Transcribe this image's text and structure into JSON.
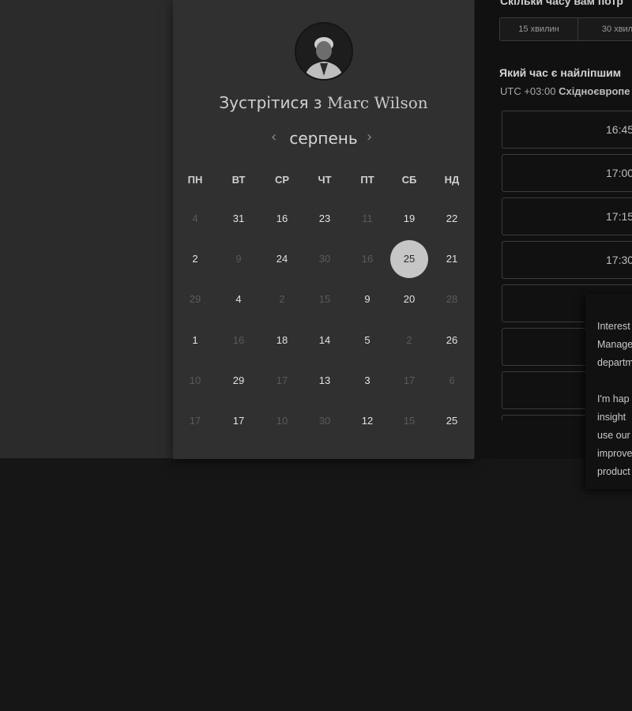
{
  "meeting": {
    "title_prefix": "Зустрітися з",
    "host_name": "Marc Wilson"
  },
  "calendar": {
    "month": "серпень",
    "prev_icon": "chevron-left-icon",
    "next_icon": "chevron-right-icon",
    "weekdays": [
      "ПН",
      "ВТ",
      "СР",
      "ЧТ",
      "ПТ",
      "СБ",
      "НД"
    ],
    "weeks": [
      [
        {
          "d": "4",
          "on": false
        },
        {
          "d": "31",
          "on": true
        },
        {
          "d": "16",
          "on": true
        },
        {
          "d": "23",
          "on": true
        },
        {
          "d": "11",
          "on": false
        },
        {
          "d": "19",
          "on": true
        },
        {
          "d": "22",
          "on": true
        }
      ],
      [
        {
          "d": "2",
          "on": true
        },
        {
          "d": "9",
          "on": false
        },
        {
          "d": "24",
          "on": true
        },
        {
          "d": "30",
          "on": false
        },
        {
          "d": "16",
          "on": false
        },
        {
          "d": "25",
          "on": true,
          "selected": true
        },
        {
          "d": "21",
          "on": true
        }
      ],
      [
        {
          "d": "29",
          "on": false
        },
        {
          "d": "4",
          "on": true
        },
        {
          "d": "2",
          "on": false
        },
        {
          "d": "15",
          "on": false
        },
        {
          "d": "9",
          "on": true
        },
        {
          "d": "20",
          "on": true
        },
        {
          "d": "28",
          "on": false
        }
      ],
      [
        {
          "d": "1",
          "on": true
        },
        {
          "d": "16",
          "on": false
        },
        {
          "d": "18",
          "on": true
        },
        {
          "d": "14",
          "on": true
        },
        {
          "d": "5",
          "on": true
        },
        {
          "d": "2",
          "on": false
        },
        {
          "d": "26",
          "on": true
        }
      ],
      [
        {
          "d": "10",
          "on": false
        },
        {
          "d": "29",
          "on": true
        },
        {
          "d": "17",
          "on": false
        },
        {
          "d": "13",
          "on": true
        },
        {
          "d": "3",
          "on": true
        },
        {
          "d": "17",
          "on": false
        },
        {
          "d": "6",
          "on": false
        }
      ],
      [
        {
          "d": "17",
          "on": false
        },
        {
          "d": "17",
          "on": true
        },
        {
          "d": "10",
          "on": false
        },
        {
          "d": "30",
          "on": false
        },
        {
          "d": "12",
          "on": true
        },
        {
          "d": "15",
          "on": false
        },
        {
          "d": "25",
          "on": true
        }
      ]
    ]
  },
  "duration": {
    "question": "Скільки часу вам потр",
    "options": [
      "15 хвилин",
      "30 хвил"
    ]
  },
  "best_time": {
    "question": "Який час є найліпшим",
    "tz_offset": "UTC +03:00",
    "tz_name": "Східноєвропе"
  },
  "slots": [
    "16:45",
    "17:00",
    "17:15",
    "17:30",
    "",
    "",
    "",
    ""
  ],
  "tooltip": {
    "paragraph1": [
      "Interest",
      "Manage",
      "departm"
    ],
    "paragraph2": [
      "I'm hap",
      "insight",
      "use our",
      "improve",
      "product"
    ]
  }
}
